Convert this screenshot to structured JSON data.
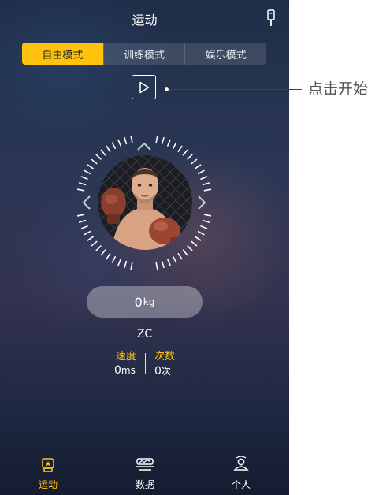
{
  "header": {
    "title": "运动"
  },
  "mode_tabs": [
    {
      "label": "自由模式",
      "active": true
    },
    {
      "label": "训练模式",
      "active": false
    },
    {
      "label": "娱乐模式",
      "active": false
    }
  ],
  "accent_color": "#ffc30f",
  "weight": {
    "value": "0",
    "unit": "kg"
  },
  "user": {
    "name": "ZC"
  },
  "stats": {
    "speed": {
      "label": "速度",
      "value": "0",
      "unit": "ms"
    },
    "count": {
      "label": "次数",
      "value": "0",
      "unit": "次"
    }
  },
  "bottom_nav": [
    {
      "label": "运动",
      "icon": "glove-icon",
      "active": true
    },
    {
      "label": "数据",
      "icon": "data-icon",
      "active": false
    },
    {
      "label": "个人",
      "icon": "person-icon",
      "active": false
    }
  ],
  "annotation": {
    "text": "点击开始"
  }
}
